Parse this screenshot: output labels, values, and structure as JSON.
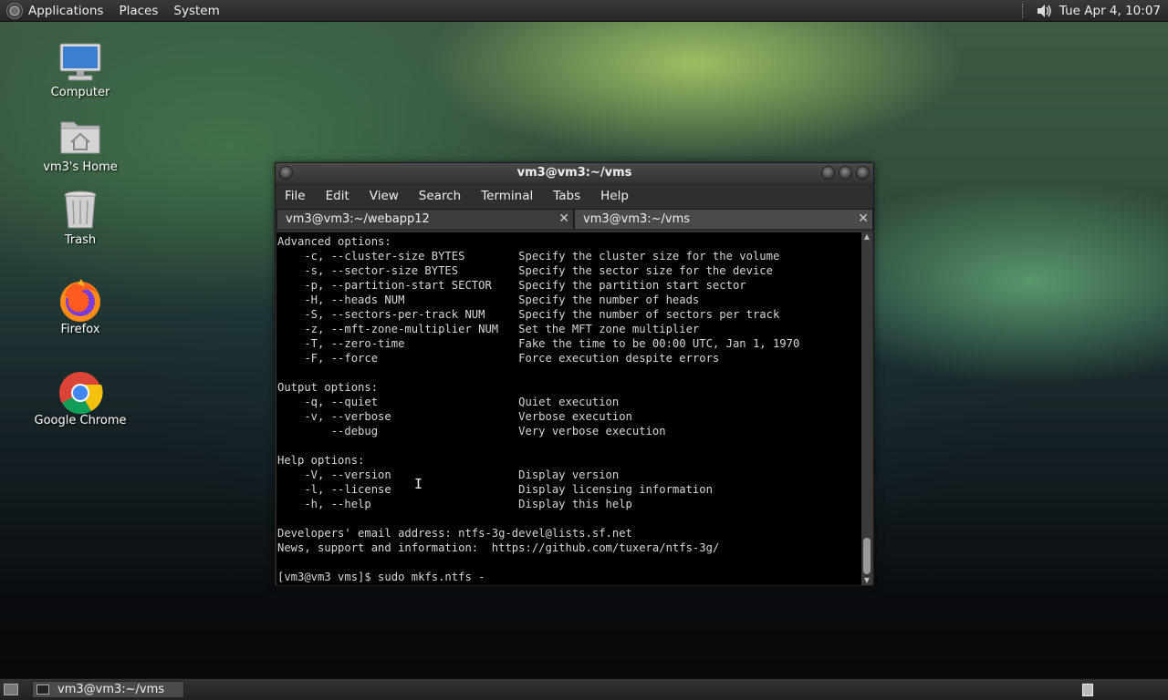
{
  "top_panel": {
    "menus": [
      "Applications",
      "Places",
      "System"
    ],
    "clock": "Tue Apr  4, 10:07"
  },
  "desktop_icons": [
    {
      "label": "Computer",
      "icon": "computer-icon"
    },
    {
      "label": "vm3's Home",
      "icon": "home-folder-icon"
    },
    {
      "label": "Trash",
      "icon": "trash-icon"
    },
    {
      "label": "Firefox",
      "icon": "firefox-icon"
    },
    {
      "label": "Google Chrome",
      "icon": "chrome-icon"
    }
  ],
  "window": {
    "title": "vm3@vm3:~/vms",
    "menu": [
      "File",
      "Edit",
      "View",
      "Search",
      "Terminal",
      "Tabs",
      "Help"
    ],
    "tabs": [
      {
        "label": "vm3@vm3:~/webapp12",
        "active": false
      },
      {
        "label": "vm3@vm3:~/vms",
        "active": true
      }
    ],
    "terminal_text": "Advanced options:\n    -c, --cluster-size BYTES        Specify the cluster size for the volume\n    -s, --sector-size BYTES         Specify the sector size for the device\n    -p, --partition-start SECTOR    Specify the partition start sector\n    -H, --heads NUM                 Specify the number of heads\n    -S, --sectors-per-track NUM     Specify the number of sectors per track\n    -z, --mft-zone-multiplier NUM   Set the MFT zone multiplier\n    -T, --zero-time                 Fake the time to be 00:00 UTC, Jan 1, 1970\n    -F, --force                     Force execution despite errors\n\nOutput options:\n    -q, --quiet                     Quiet execution\n    -v, --verbose                   Verbose execution\n        --debug                     Very verbose execution\n\nHelp options:\n    -V, --version                   Display version\n    -l, --license                   Display licensing information\n    -h, --help                      Display this help\n\nDevelopers' email address: ntfs-3g-devel@lists.sf.net\nNews, support and information:  https://github.com/tuxera/ntfs-3g/\n\n[vm3@vm3 vms]$ sudo mkfs.ntfs -"
  },
  "taskbar": {
    "task_label": "vm3@vm3:~/vms"
  }
}
